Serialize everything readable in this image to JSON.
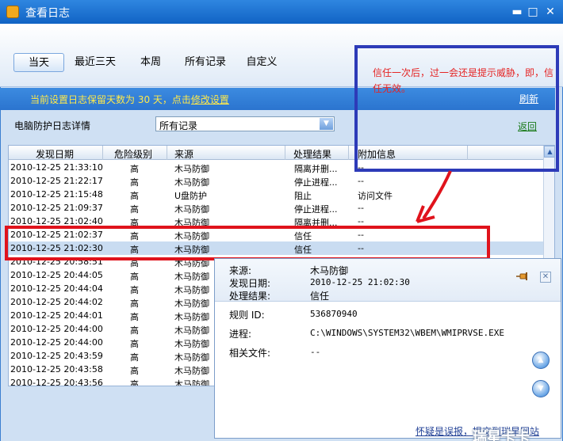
{
  "window": {
    "title": "查看日志"
  },
  "tabs": [
    {
      "label": "当天",
      "active": true
    },
    {
      "label": "最近三天",
      "active": false
    },
    {
      "label": "本周",
      "active": false
    },
    {
      "label": "所有记录",
      "active": false
    },
    {
      "label": "自定义",
      "active": false
    }
  ],
  "info": {
    "prefix": "当前设置日志保留天数为 30 天，点击",
    "link": "修改设置",
    "refresh": "刷新"
  },
  "filter": {
    "label": "电脑防护日志详情",
    "selected": "所有记录",
    "back": "返回"
  },
  "columns": [
    "发现日期",
    "危险级别",
    "来源",
    "处理结果",
    "附加信息"
  ],
  "rows": [
    {
      "date": "2010-12-25 21:33:10",
      "level": "高",
      "source": "木马防御",
      "result": "隔离并删...",
      "info": "--"
    },
    {
      "date": "2010-12-25 21:22:17",
      "level": "高",
      "source": "木马防御",
      "result": "停止进程...",
      "info": "--"
    },
    {
      "date": "2010-12-25 21:15:48",
      "level": "高",
      "source": "U盘防护",
      "result": "阻止",
      "info": "访问文件"
    },
    {
      "date": "2010-12-25 21:09:37",
      "level": "高",
      "source": "木马防御",
      "result": "停止进程...",
      "info": "--"
    },
    {
      "date": "2010-12-25 21:02:40",
      "level": "高",
      "source": "木马防御",
      "result": "隔离并删...",
      "info": "--"
    },
    {
      "date": "2010-12-25 21:02:37",
      "level": "高",
      "source": "木马防御",
      "result": "信任",
      "info": "--"
    },
    {
      "date": "2010-12-25 21:02:30",
      "level": "高",
      "source": "木马防御",
      "result": "信任",
      "info": "--"
    },
    {
      "date": "2010-12-25 20:58:51",
      "level": "高",
      "source": "木马防御",
      "result": "隔离并删...",
      "info": "--"
    },
    {
      "date": "2010-12-25 20:44:05",
      "level": "高",
      "source": "木马防御",
      "result": "",
      "info": ""
    },
    {
      "date": "2010-12-25 20:44:04",
      "level": "高",
      "source": "木马防御",
      "result": "",
      "info": ""
    },
    {
      "date": "2010-12-25 20:44:02",
      "level": "高",
      "source": "木马防御",
      "result": "",
      "info": ""
    },
    {
      "date": "2010-12-25 20:44:01",
      "level": "高",
      "source": "木马防御",
      "result": "",
      "info": ""
    },
    {
      "date": "2010-12-25 20:44:00",
      "level": "高",
      "source": "木马防御",
      "result": "",
      "info": ""
    },
    {
      "date": "2010-12-25 20:44:00",
      "level": "高",
      "source": "木马防御",
      "result": "",
      "info": ""
    },
    {
      "date": "2010-12-25 20:43:59",
      "level": "高",
      "source": "木马防御",
      "result": "",
      "info": ""
    },
    {
      "date": "2010-12-25 20:43:58",
      "level": "高",
      "source": "木马防御",
      "result": "",
      "info": ""
    },
    {
      "date": "2010-12-25 20:43:56",
      "level": "高",
      "source": "木马防御",
      "result": "",
      "info": ""
    }
  ],
  "selected_row": 6,
  "annotation": "信任一次后，过一会还是提示威胁，即，信任无效。",
  "popup": {
    "source_label": "来源:",
    "source": "木马防御",
    "date_label": "发现日期:",
    "date": "2010-12-25 21:02:30",
    "result_label": "处理结果:",
    "result": "信任",
    "rule_label": "规则 ID:",
    "rule": "536870940",
    "process_label": "进程:",
    "process": "C:\\WINDOWS\\SYSTEM32\\WBEM\\WMIPRVSE.EXE",
    "file_label": "相关文件:",
    "file": "--",
    "report": "怀疑是误报，提交到瑞星网站"
  },
  "watermark": "瑞星卡卡",
  "colors": {
    "titlebar": "#1a6fd0",
    "annotation_red": "#e0131c",
    "annotation_blue": "#2d3bb8",
    "info_text": "#ffe94a"
  }
}
